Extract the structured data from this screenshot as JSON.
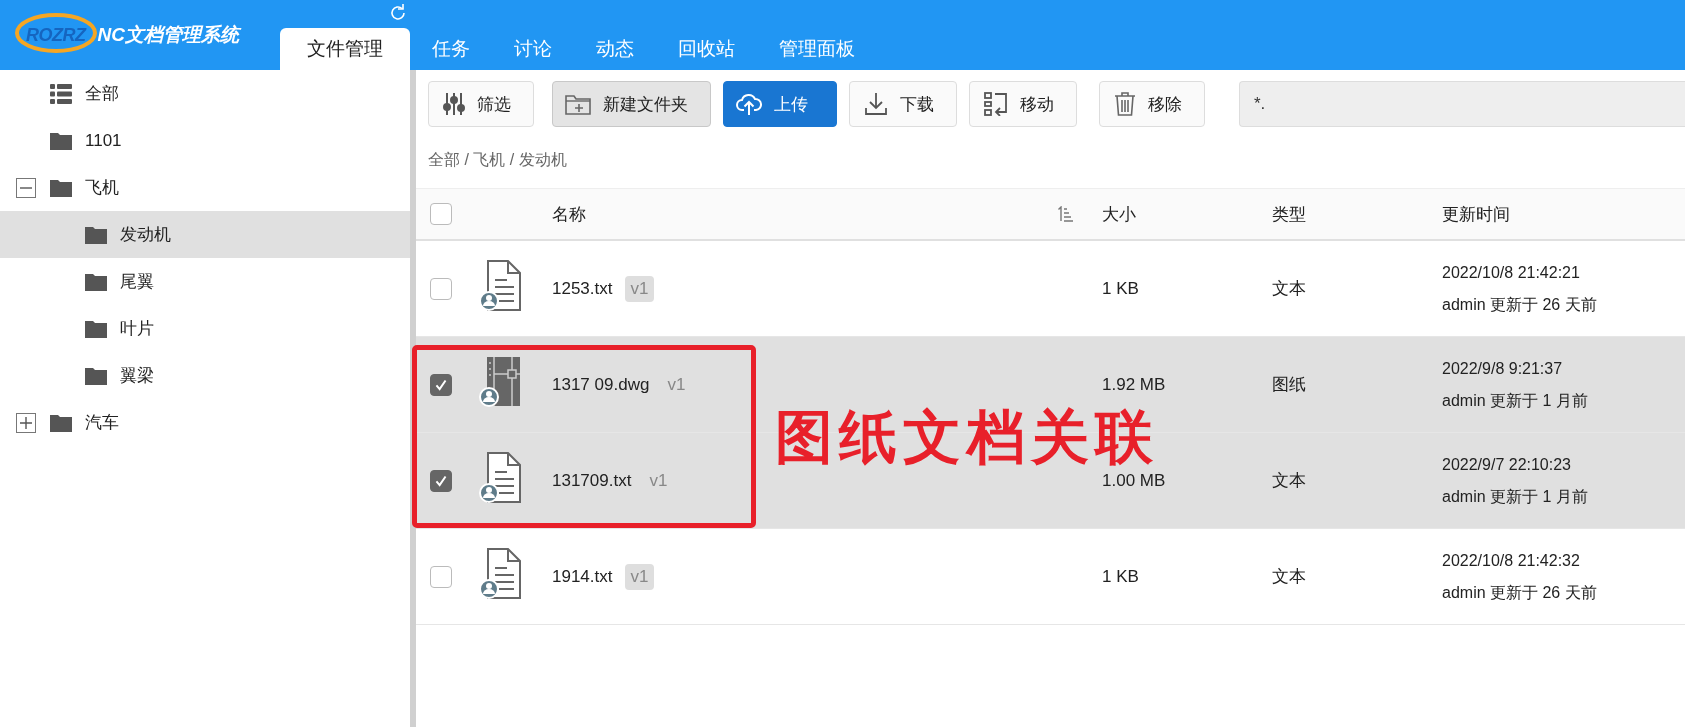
{
  "header": {
    "logo_mark": "ROZRZ",
    "logo_text": "NC文档管理系统"
  },
  "tabs": [
    {
      "label": "文件管理",
      "selected": true
    },
    {
      "label": "任务",
      "selected": false
    },
    {
      "label": "讨论",
      "selected": false
    },
    {
      "label": "动态",
      "selected": false
    },
    {
      "label": "回收站",
      "selected": false
    },
    {
      "label": "管理面板",
      "selected": false
    }
  ],
  "tree": [
    {
      "label": "全部",
      "kind": "list",
      "selected": false
    },
    {
      "label": "1101",
      "kind": "folder",
      "selected": false
    },
    {
      "label": "飞机",
      "kind": "folder",
      "selected": false,
      "expanded": true,
      "children": [
        {
          "label": "发动机",
          "kind": "folder",
          "selected": true
        },
        {
          "label": "尾翼",
          "kind": "folder",
          "selected": false
        },
        {
          "label": "叶片",
          "kind": "folder",
          "selected": false
        },
        {
          "label": "翼梁",
          "kind": "folder",
          "selected": false
        }
      ]
    },
    {
      "label": "汽车",
      "kind": "folder",
      "selected": false,
      "expanded": false
    }
  ],
  "toolbar": {
    "buttons": [
      {
        "label": "筛选",
        "kind": "filter"
      },
      {
        "label": "新建文件夹",
        "kind": "new-folder"
      },
      {
        "label": "上传",
        "kind": "upload"
      },
      {
        "label": "下载",
        "kind": "download"
      },
      {
        "label": "移动",
        "kind": "move"
      },
      {
        "label": "移除",
        "kind": "delete"
      }
    ],
    "search": {
      "value": "*."
    }
  },
  "breadcrumb": "全部 / 飞机 / 发动机",
  "table": {
    "all_checked": false,
    "columns": [
      "名称",
      "大小",
      "类型",
      "更新时间"
    ],
    "rows": [
      {
        "name": "1253.txt",
        "version": "v1",
        "size": "1 KB",
        "type": "文本",
        "time": "2022/10/8 21:42:21",
        "by": "admin 更新于 26 天前",
        "kind": "text",
        "checked": false
      },
      {
        "name": "1317 09.dwg",
        "version": "v1",
        "size": "1.92 MB",
        "type": "图纸",
        "time": "2022/9/8 9:21:37",
        "by": "admin 更新于 1 月前",
        "kind": "drawing",
        "checked": true
      },
      {
        "name": "131709.txt",
        "version": "v1",
        "size": "1.00 MB",
        "type": "文本",
        "time": "2022/9/7 22:10:23",
        "by": "admin 更新于 1 月前",
        "kind": "text",
        "checked": true
      },
      {
        "name": "1914.txt",
        "version": "v1",
        "size": "1 KB",
        "type": "文本",
        "time": "2022/10/8 21:42:32",
        "by": "admin 更新于 26 天前",
        "kind": "text",
        "checked": false
      }
    ]
  },
  "annotation": {
    "text": "图纸文档关联"
  }
}
